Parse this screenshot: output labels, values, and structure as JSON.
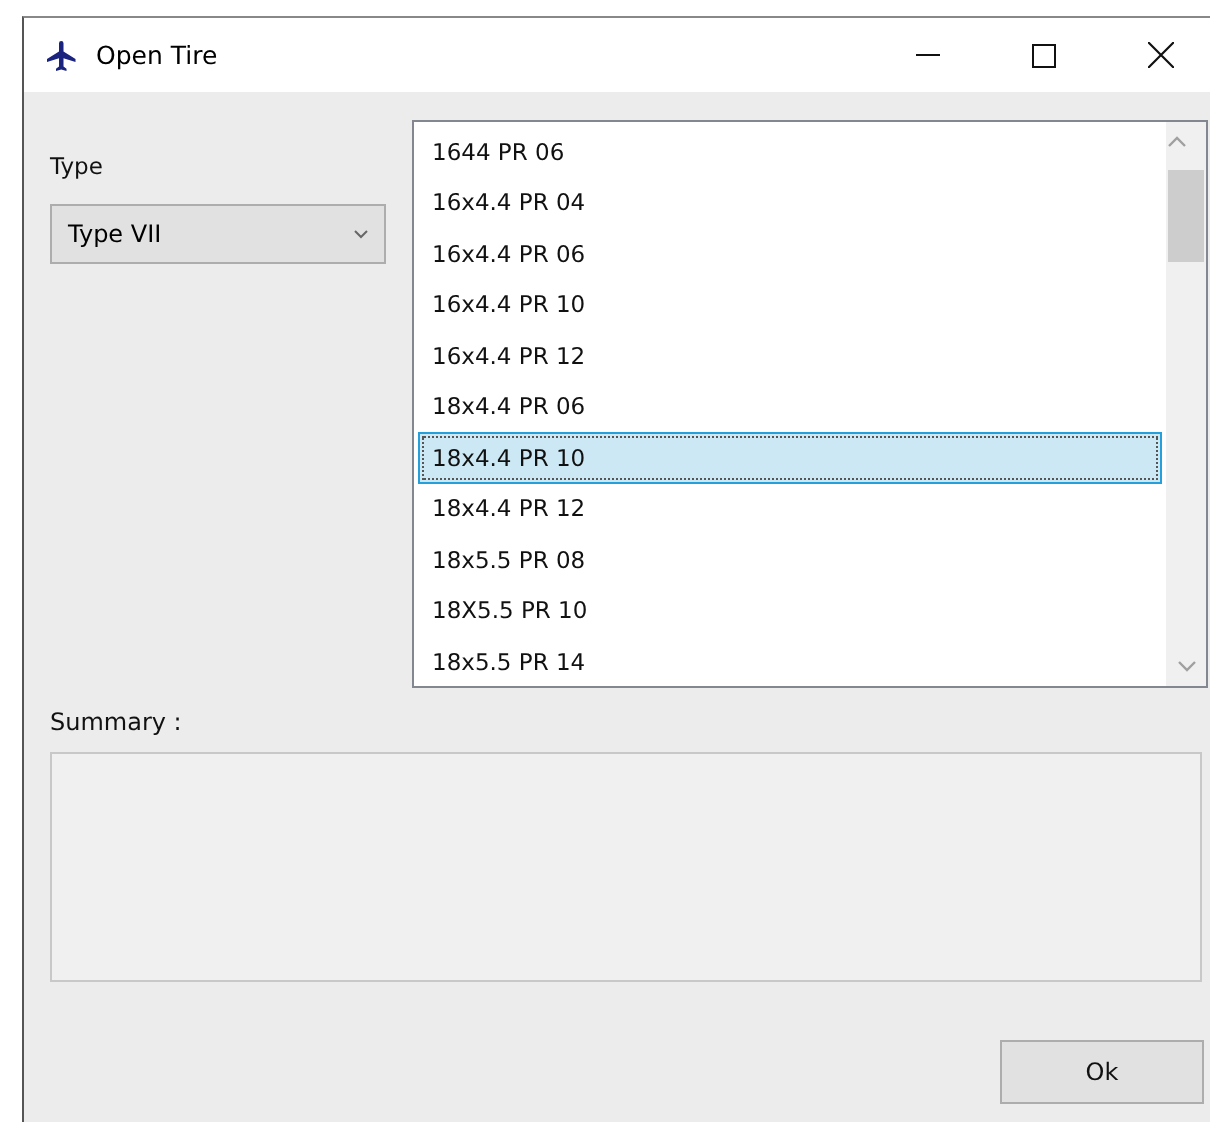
{
  "window": {
    "title": "Open Tire"
  },
  "type_label": "Type",
  "type_select": {
    "value": "Type VII"
  },
  "tires": [
    {
      "label": "1644 PR 06",
      "selected": false
    },
    {
      "label": "16x4.4 PR 04",
      "selected": false
    },
    {
      "label": "16x4.4 PR 06",
      "selected": false
    },
    {
      "label": "16x4.4 PR 10",
      "selected": false
    },
    {
      "label": "16x4.4 PR 12",
      "selected": false
    },
    {
      "label": "18x4.4 PR 06",
      "selected": false
    },
    {
      "label": "18x4.4 PR 10",
      "selected": true
    },
    {
      "label": "18x4.4 PR 12",
      "selected": false
    },
    {
      "label": "18x5.5 PR 08",
      "selected": false
    },
    {
      "label": "18X5.5 PR 10",
      "selected": false
    },
    {
      "label": "18x5.5 PR 14",
      "selected": false
    }
  ],
  "summary_label": "Summary :",
  "buttons": [
    "Ok"
  ]
}
